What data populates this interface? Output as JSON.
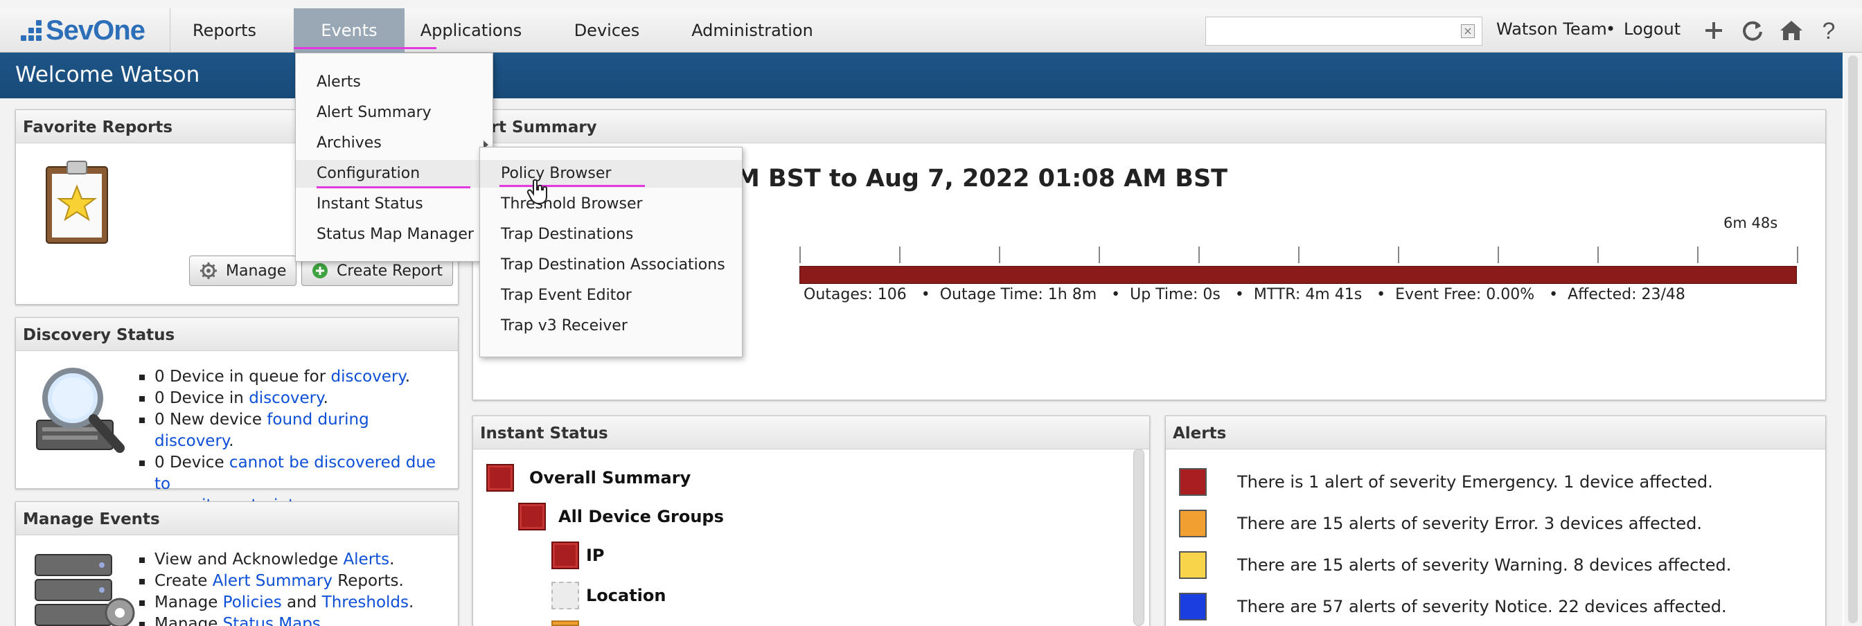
{
  "app": {
    "logo_text": "SevOne",
    "brand_color": "#2c6fb8",
    "header_color": "#1b5282"
  },
  "nav": {
    "items": [
      "Reports",
      "Events",
      "Applications",
      "Devices",
      "Administration"
    ],
    "active": "Events"
  },
  "search": {
    "placeholder": "",
    "value": ""
  },
  "user": {
    "name": "Watson Team",
    "separator": "•",
    "logout": "Logout"
  },
  "toolbar_icons": [
    "add-icon",
    "refresh-icon",
    "home-icon",
    "help-icon"
  ],
  "header": {
    "welcome": "Welcome Watson"
  },
  "events_menu": {
    "items": [
      "Alerts",
      "Alert Summary",
      "Archives",
      "Configuration",
      "Instant Status",
      "Status Map Manager"
    ],
    "highlighted": "Configuration"
  },
  "configuration_submenu": {
    "items": [
      "Policy Browser",
      "Threshold Browser",
      "Trap Destinations",
      "Trap Destination Associations",
      "Trap Event Editor",
      "Trap v3 Receiver"
    ],
    "highlighted": "Policy Browser"
  },
  "favorite_reports": {
    "title": "Favorite Reports",
    "manage_label": "Manage",
    "create_label": "Create Report"
  },
  "discovery": {
    "title": "Discovery Status",
    "lines": [
      {
        "text": "0 Device in queue for ",
        "link": "discovery",
        "tail": "."
      },
      {
        "text": "0 Device in ",
        "link": "discovery",
        "tail": "."
      },
      {
        "text": "0 New device ",
        "link": "found during discovery",
        "tail": "."
      },
      {
        "text": "0 Device ",
        "link": "cannot be discovered due to",
        "link2": "capacity restraints",
        "tail": "."
      }
    ]
  },
  "manage_events": {
    "title": "Manage Events",
    "lines": [
      {
        "text": "View and Acknowledge ",
        "link": "Alerts",
        "tail": "."
      },
      {
        "text": "Create ",
        "link": "Alert Summary",
        "tail": " Reports."
      },
      {
        "text": "Manage ",
        "link": "Policies",
        "mid": " and ",
        "link2": "Thresholds",
        "tail": "."
      },
      {
        "text": "Manage ",
        "link": "Status Maps",
        "tail": "."
      }
    ]
  },
  "alert_summary": {
    "title_visible": "ert Summary",
    "range_visible": "M BST to Aug 7, 2022 01:08 AM BST",
    "duration_label": "6m 48s",
    "bar_color": "#8b1a1a",
    "stats": {
      "outages": "Outages: 106",
      "outage_time": "Outage Time: 1h 8m",
      "up_time": "Up Time: 0s",
      "mttr": "MTTR: 4m 41s",
      "event_free": "Event Free: 0.00%",
      "affected": "Affected: 23/48"
    }
  },
  "instant_status": {
    "title": "Instant Status",
    "rows": [
      {
        "label": "Overall Summary",
        "status": "red"
      },
      {
        "label": "All Device Groups",
        "status": "red"
      },
      {
        "label": "IP",
        "status": "red"
      },
      {
        "label": "Location",
        "status": "none"
      }
    ]
  },
  "alerts": {
    "title": "Alerts",
    "rows": [
      {
        "text": "There is 1 alert of severity Emergency. 1 device affected.",
        "color": "#a91f1f"
      },
      {
        "text": "There are 15 alerts of severity Error. 3 devices affected.",
        "color": "#f0a030"
      },
      {
        "text": "There are 15 alerts of severity Warning. 8 devices affected.",
        "color": "#f8d44a"
      },
      {
        "text": "There are 57 alerts of severity Notice. 22 devices affected.",
        "color": "#1a3fe0"
      }
    ]
  }
}
